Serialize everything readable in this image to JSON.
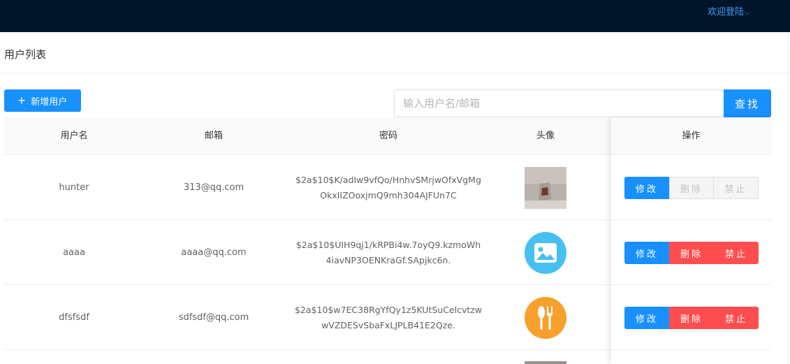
{
  "header": {
    "welcome": "欢迎登陆"
  },
  "page": {
    "title": "用户列表"
  },
  "toolbar": {
    "add_label": "新增用户",
    "search_placeholder": "输入用户名/邮箱",
    "search_label": "查找"
  },
  "table": {
    "columns": [
      "用户名",
      "邮箱",
      "密码",
      "头像",
      "操作"
    ],
    "rows": [
      {
        "username": "hunter",
        "email": "313@qq.com",
        "password": "$2a$10$K/adIw9vfQo/HnhvSMrjwOfxVgMgOkxIIZOoxjmQ9mh304AJFUn7C",
        "avatar": "photo",
        "edit": "修改",
        "delete": "删除",
        "ban": "禁止",
        "disabled": true
      },
      {
        "username": "aaaa",
        "email": "aaaa@qq.com",
        "password": "$2a$10$UIH9qj1/kRPBi4w.7oyQ9.kzmoWh4iavNP3OENKraGf.SApjkc6n.",
        "avatar": "image-icon",
        "avatar_color": "#48bff1",
        "edit": "修改",
        "delete": "删除",
        "ban": "禁止",
        "disabled": false
      },
      {
        "username": "dfsfsdf",
        "email": "sdfsdf@qq.com",
        "password": "$2a$10$w7EC38RgYfQy1z5KUtSuCelcvtzwwVZDESvSbaFxLJPLB41E2Qze.",
        "avatar": "fork-knife-icon",
        "avatar_color": "#f7a02c",
        "edit": "修改",
        "delete": "删除",
        "ban": "禁止",
        "disabled": false
      }
    ]
  },
  "colors": {
    "topbar": "#001529",
    "primary": "#1890ff",
    "danger": "#ff4d4f",
    "link": "#409eff"
  }
}
